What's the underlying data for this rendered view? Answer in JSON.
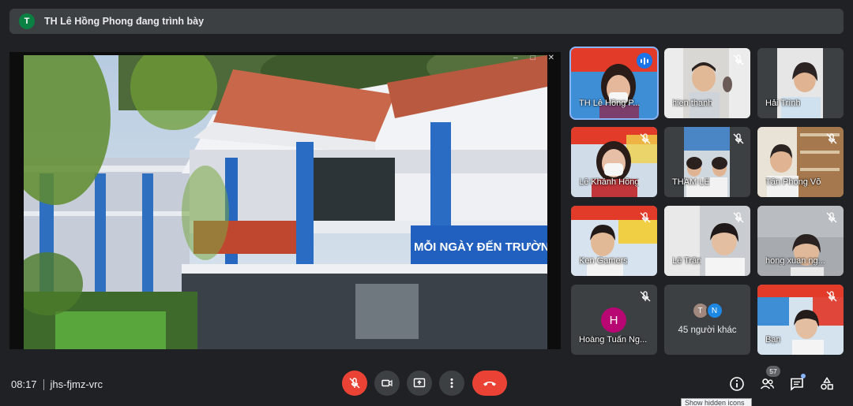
{
  "banner": {
    "avatar_letter": "T",
    "text": "TH Lê Hồng Phong đang trình bày"
  },
  "presentation": {
    "banner_text": "MỖI NGÀY ĐẾN TRƯỜNG LÀ MỘT"
  },
  "participants": [
    {
      "name": "TH Lê Hồng P...",
      "tile_text": "KHAI GIA",
      "state": "speaking"
    },
    {
      "name": "hien thanh",
      "state": "muted"
    },
    {
      "name": "Hải Trình",
      "state": "none"
    },
    {
      "name": "Lê Khánh Hồng",
      "tile_text": "KHAI GIA",
      "state": "muted"
    },
    {
      "name": "THẢM LÊ",
      "state": "muted"
    },
    {
      "name": "Tấn Phong Võ",
      "state": "muted"
    },
    {
      "name": "Ken Gamers",
      "tile_text": "KHAI GIAN",
      "state": "muted"
    },
    {
      "name": "Lê Trân",
      "state": "muted"
    },
    {
      "name": "hong xuan ng...",
      "state": "muted"
    },
    {
      "name": "Hoàng Tuấn Ng...",
      "avatar_letter": "H",
      "state": "muted"
    },
    {
      "name": "Bạn",
      "tile_text": "KHAI GIAN",
      "state": "muted"
    }
  ],
  "others_tile": {
    "avatars": [
      "T",
      "N"
    ],
    "label": "45 người khác"
  },
  "bottom": {
    "time": "08:17",
    "meeting_code": "jhs-fjmz-vrc",
    "people_count": "57",
    "tooltip": "Show hidden icons"
  },
  "colors": {
    "background": "#202124",
    "danger": "#ea4335",
    "accent": "#8ab4f8",
    "tile": "#3c4043"
  }
}
